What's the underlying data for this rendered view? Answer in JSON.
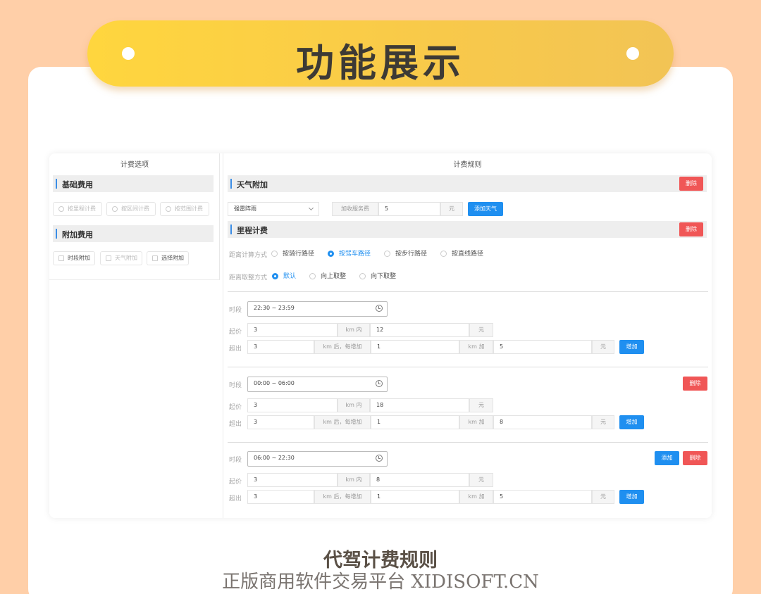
{
  "banner": {
    "title": "功能展示"
  },
  "left": {
    "header": "计费选项",
    "base_section": "基础费用",
    "base_options": [
      "按里程计费",
      "按区间计费",
      "按范围计费"
    ],
    "extra_section": "附加费用",
    "extra_options": [
      "时段附加",
      "天气附加",
      "选择附加"
    ]
  },
  "right": {
    "header": "计费规则",
    "weather": {
      "title": "天气附加",
      "delete": "删除",
      "weather_select": "强雷阵雨",
      "fee_label": "加收服务费",
      "fee_value": "5",
      "unit": "元",
      "add_button": "添加天气"
    },
    "mileage": {
      "title": "里程计费",
      "delete": "删除",
      "calc_label": "距离计算方式",
      "calc_options": [
        "按骑行路径",
        "按驾车路径",
        "按步行路径",
        "按直线路径"
      ],
      "calc_selected": "按驾车路径",
      "round_label": "距离取整方式",
      "round_options": [
        "默认",
        "向上取整",
        "向下取整"
      ],
      "round_selected": "默认"
    },
    "periods": [
      {
        "time_label": "时段",
        "time": "22:30 ~ 23:59",
        "start_label": "起价",
        "start_km": "3",
        "km_in": "km 内",
        "start_price": "12",
        "unit": "元",
        "over_label": "超出",
        "over_km": "3",
        "km_after": "km 后，每增加",
        "step_km": "1",
        "km_add": "km 加",
        "step_price": "5",
        "add_button": "增加"
      },
      {
        "time_label": "时段",
        "time": "00:00 ~ 06:00",
        "start_label": "起价",
        "start_km": "3",
        "km_in": "km 内",
        "start_price": "18",
        "unit": "元",
        "over_label": "超出",
        "over_km": "3",
        "km_after": "km 后，每增加",
        "step_km": "1",
        "km_add": "km 加",
        "step_price": "8",
        "add_button": "增加",
        "delete": "删除"
      },
      {
        "time_label": "时段",
        "time": "06:00 ~ 22:30",
        "start_label": "起价",
        "start_km": "3",
        "km_in": "km 内",
        "start_price": "8",
        "unit": "元",
        "over_label": "超出",
        "over_km": "3",
        "km_after": "km 后，每增加",
        "step_km": "1",
        "km_add": "km 加",
        "step_price": "5",
        "add_button": "增加",
        "new_button": "添加",
        "delete": "删除"
      }
    ]
  },
  "caption": {
    "title": "代驾计费规则",
    "watermark": "正版商用软件交易平台 XIDISOFT.CN"
  }
}
